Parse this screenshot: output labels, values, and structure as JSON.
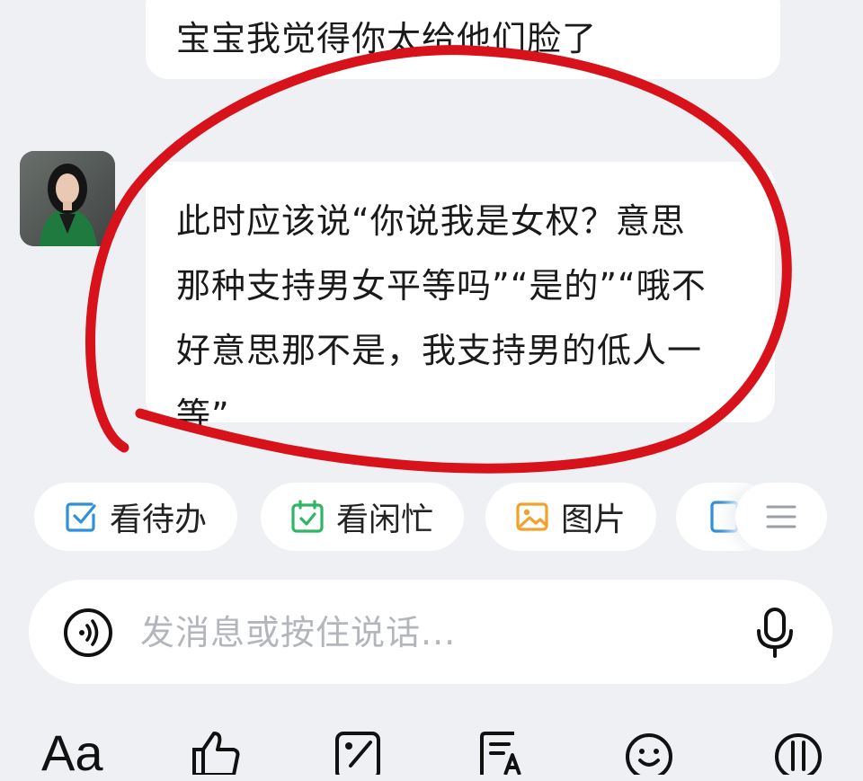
{
  "messages": [
    {
      "text": "宝宝我觉得你太给他们脸了"
    },
    {
      "text": "此时应该说“你说我是女权？意思\n那种支持男女平等吗”“是的”“哦不\n好意思那不是，我支持男的低人一\n等”"
    }
  ],
  "quick_actions": [
    {
      "label": "看待办",
      "icon": "checkbox-icon",
      "color": "#2f8fd8"
    },
    {
      "label": "看闲忙",
      "icon": "calendar-check-icon",
      "color": "#2fb566"
    },
    {
      "label": "图片",
      "icon": "image-icon",
      "color": "#f0a22a"
    },
    {
      "label": "",
      "icon": "document-icon",
      "color": "#2f8fd8"
    }
  ],
  "input": {
    "placeholder": "发消息或按住说话..."
  },
  "toolbar": {
    "font_label": "Aa"
  },
  "colors": {
    "annotation": "#d8121b",
    "background": "#eef0f3"
  }
}
